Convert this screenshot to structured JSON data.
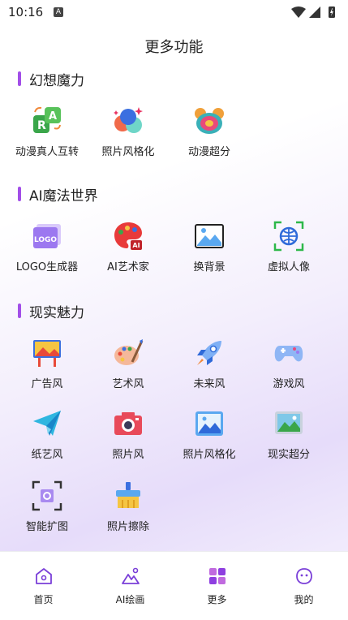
{
  "status_bar": {
    "time": "10:16",
    "notification_glyph": "A"
  },
  "page": {
    "title": "更多功能"
  },
  "sections": [
    {
      "title": "幻想魔力",
      "items": [
        {
          "label": "动漫真人互转",
          "icon": "anime-real-swap-icon"
        },
        {
          "label": "照片风格化",
          "icon": "photo-stylize-bubbles-icon"
        },
        {
          "label": "动漫超分",
          "icon": "anime-upscale-icon"
        }
      ]
    },
    {
      "title": "AI魔法世界",
      "items": [
        {
          "label": "LOGO生成器",
          "icon": "logo-generator-icon",
          "icon_text": "LOGO"
        },
        {
          "label": "AI艺术家",
          "icon": "ai-artist-palette-icon",
          "icon_text": "AI"
        },
        {
          "label": "换背景",
          "icon": "change-background-icon"
        },
        {
          "label": "虚拟人像",
          "icon": "virtual-portrait-icon"
        }
      ]
    },
    {
      "title": "现实魅力",
      "items": [
        {
          "label": "广告风",
          "icon": "billboard-icon"
        },
        {
          "label": "艺术风",
          "icon": "art-palette-icon"
        },
        {
          "label": "未来风",
          "icon": "rocket-icon"
        },
        {
          "label": "游戏风",
          "icon": "gamepad-icon"
        },
        {
          "label": "纸艺风",
          "icon": "paper-plane-icon"
        },
        {
          "label": "照片风",
          "icon": "camera-icon"
        },
        {
          "label": "照片风格化",
          "icon": "photo-frame-icon"
        },
        {
          "label": "现实超分",
          "icon": "landscape-upscale-icon"
        },
        {
          "label": "智能扩图",
          "icon": "smart-expand-icon"
        },
        {
          "label": "照片擦除",
          "icon": "photo-erase-brush-icon"
        }
      ]
    }
  ],
  "tab_bar": {
    "tabs": [
      {
        "label": "首页",
        "icon": "home-icon",
        "active": false
      },
      {
        "label": "AI绘画",
        "icon": "ai-painting-icon",
        "active": false
      },
      {
        "label": "更多",
        "icon": "more-grid-icon",
        "active": true
      },
      {
        "label": "我的",
        "icon": "profile-face-icon",
        "active": false
      }
    ]
  },
  "colors": {
    "accent": "#a24ee8",
    "active_tab": "#8e3fe0",
    "text": "#222222"
  }
}
